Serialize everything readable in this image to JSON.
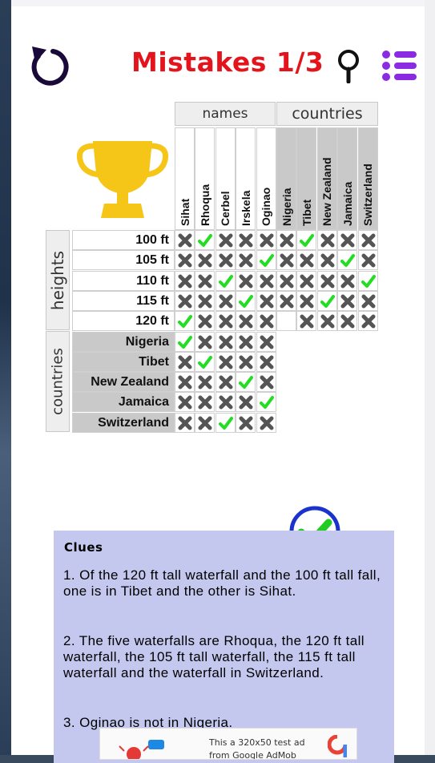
{
  "header": {
    "mistakes_text": "Mistakes 1/3",
    "accent_color": "#e4141c",
    "icons": [
      "undo-icon",
      "hint-icon",
      "menu-icon"
    ]
  },
  "grid": {
    "top_groups": [
      "names",
      "countries"
    ],
    "side_groups": [
      "heights",
      "countries"
    ],
    "columns": [
      "Sihat",
      "Rhoqua",
      "Cerbel",
      "Irskela",
      "Oginao",
      "Nigeria",
      "Tibet",
      "New Zealand",
      "Jamaica",
      "Switzerland"
    ],
    "rows": [
      "100 ft",
      "105 ft",
      "110 ft",
      "115 ft",
      "120 ft",
      "Nigeria",
      "Tibet",
      "New Zealand",
      "Jamaica",
      "Switzerland"
    ],
    "cells": [
      [
        "x",
        "v",
        "x",
        "x",
        "x",
        "x",
        "v",
        "x",
        "x",
        "x"
      ],
      [
        "x",
        "x",
        "x",
        "x",
        "v",
        "x",
        "x",
        "x",
        "v",
        "x"
      ],
      [
        "x",
        "x",
        "v",
        "x",
        "x",
        "x",
        "x",
        "x",
        "x",
        "v"
      ],
      [
        "x",
        "x",
        "x",
        "v",
        "x",
        "x",
        "x",
        "v",
        "x",
        "x"
      ],
      [
        "v",
        "x",
        "x",
        "x",
        "x",
        "",
        "x",
        "x",
        "x",
        "x"
      ],
      [
        "v",
        "x",
        "x",
        "x",
        "x"
      ],
      [
        "x",
        "v",
        "x",
        "x",
        "x"
      ],
      [
        "x",
        "x",
        "x",
        "v",
        "x"
      ],
      [
        "x",
        "x",
        "x",
        "x",
        "v"
      ],
      [
        "x",
        "x",
        "v",
        "x",
        "x"
      ]
    ]
  },
  "clues": {
    "title": "Clues",
    "items": [
      "1. Of the 120 ft tall waterfall and the 100 ft tall fall, one is in Tibet and the other is Sihat.",
      "2. The five waterfalls are Rhoqua, the 120 ft tall waterfall, the 105 ft tall waterfall, the 115 ft tall waterfall and the waterfall in Switzerland.",
      "3. Oginao is not in Nigeria."
    ]
  },
  "ad": {
    "text": "This a 320x50 test ad from Google AdMob"
  },
  "colors": {
    "check": "#22dd22",
    "cross": "#555555",
    "clue_bg": "#c4c8ee",
    "check_circle": "#1a33cc"
  }
}
